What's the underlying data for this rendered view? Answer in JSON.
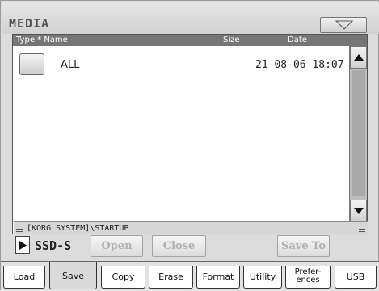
{
  "page": {
    "title": "MEDIA"
  },
  "columns": {
    "type_name": "Type * Name",
    "size": "Size",
    "date": "Date"
  },
  "files": [
    {
      "name": "ALL",
      "size": "",
      "date": "21-08-06 18:07"
    }
  ],
  "path": "[KORG SYSTEM]\\STARTUP",
  "device": {
    "label": "SSD-S"
  },
  "buttons": {
    "open": "Open",
    "close": "Close",
    "save_to": "Save To"
  },
  "tabs": [
    {
      "label": "Load"
    },
    {
      "label": "Save",
      "active": true
    },
    {
      "label": "Copy"
    },
    {
      "label": "Erase"
    },
    {
      "label": "Format"
    },
    {
      "label": "Utility"
    },
    {
      "label_line1": "Prefer-",
      "label_line2": "ences"
    },
    {
      "label": "USB"
    }
  ],
  "colors": {
    "header": "#767676",
    "disabled_text": "#b3b3b3",
    "panel": "#dcdcdc"
  }
}
